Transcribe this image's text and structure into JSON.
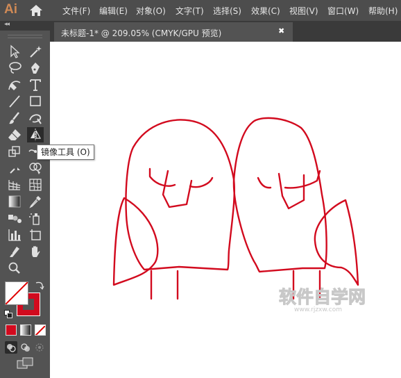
{
  "app": {
    "logo": "Ai",
    "home_icon": "home-icon"
  },
  "menu": [
    {
      "label": "文件(F)"
    },
    {
      "label": "编辑(E)"
    },
    {
      "label": "对象(O)"
    },
    {
      "label": "文字(T)"
    },
    {
      "label": "选择(S)"
    },
    {
      "label": "效果(C)"
    },
    {
      "label": "视图(V)"
    },
    {
      "label": "窗口(W)"
    },
    {
      "label": "帮助(H)"
    }
  ],
  "document": {
    "tab_title": "未标题-1* @ 209.05% (CMYK/GPU 预览)",
    "close_label": "✖"
  },
  "tooltip": {
    "text": "镜像工具 (O)"
  },
  "toolbar": {
    "collapse_label": "◂◂",
    "active_tool": "reflect-tool"
  },
  "colors": {
    "stroke": "#d20a1e",
    "accent": "#d08a56",
    "toolbar_bg": "#535353",
    "menubar_bg": "#4d4d4d"
  },
  "watermark": {
    "title": "软件自学网",
    "url": "www.rjzxw.com"
  }
}
